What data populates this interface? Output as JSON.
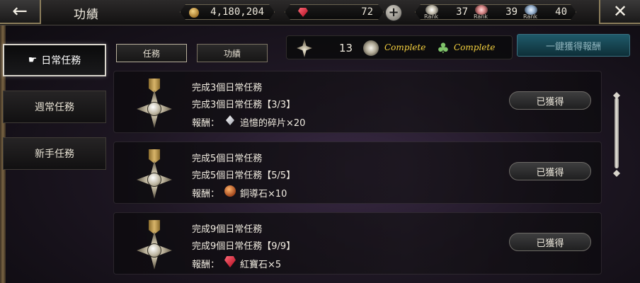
{
  "header": {
    "title": "功績",
    "gold": "4,180,204",
    "gems": "72",
    "ranks": [
      {
        "label": "Rank",
        "value": "37",
        "icon": "silver-medal-icon"
      },
      {
        "label": "Rank",
        "value": "39",
        "icon": "rose-medal-icon"
      },
      {
        "label": "Rank",
        "value": "40",
        "icon": "blue-medal-icon"
      }
    ]
  },
  "sidebar": {
    "items": [
      {
        "label": "日常任務",
        "active": true
      },
      {
        "label": "週常任務",
        "active": false
      },
      {
        "label": "新手任務",
        "active": false
      }
    ]
  },
  "tabs": [
    {
      "label": "任務"
    },
    {
      "label": "功績"
    }
  ],
  "summary": {
    "count": "13",
    "complete_1": "Complete",
    "complete_2": "Complete"
  },
  "claim_all_label": "一鍵獲得報酬",
  "quests": [
    {
      "title": "完成3個日常任務",
      "progress": "完成3個日常任務【3/3】",
      "reward_label": "報酬：",
      "reward": "追憶的碎片×20",
      "reward_icon": "shard-icon",
      "status": "已獲得"
    },
    {
      "title": "完成5個日常任務",
      "progress": "完成5個日常任務【5/5】",
      "reward_label": "報酬：",
      "reward": "銅導石×10",
      "reward_icon": "copper-stone-icon",
      "status": "已獲得"
    },
    {
      "title": "完成9個日常任務",
      "progress": "完成9個日常任務【9/9】",
      "reward_label": "報酬：",
      "reward": "紅寶石×5",
      "reward_icon": "ruby-icon",
      "status": "已獲得"
    }
  ],
  "colors": {
    "complete_text": "#f4d03f",
    "claim_button": "#1f5a6a",
    "ruby": "#c8102e"
  }
}
